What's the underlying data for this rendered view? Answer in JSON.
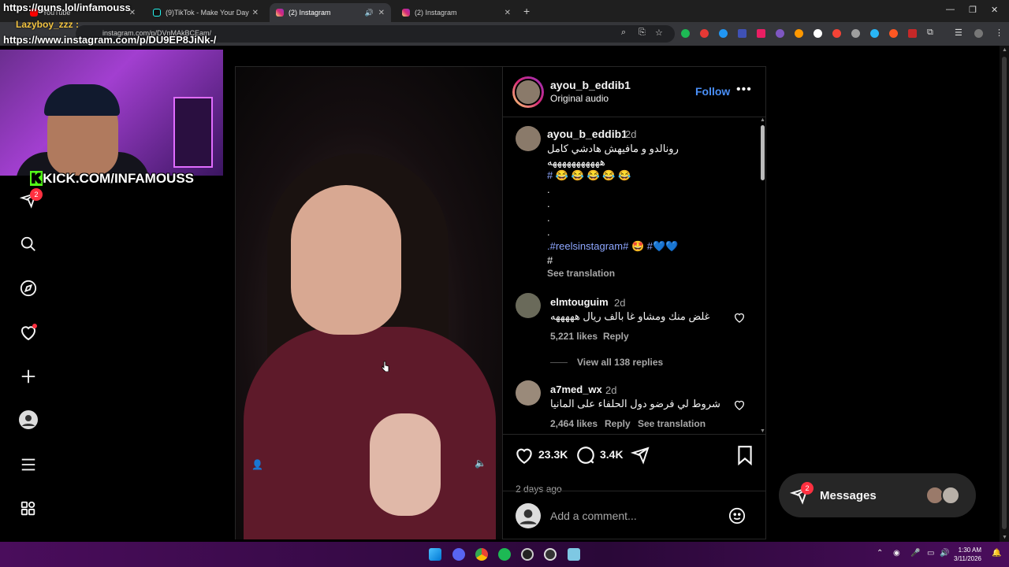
{
  "overlay": {
    "url1": "https://guns.lol/infamouss",
    "user": "Lazyboy_zzz :",
    "url2": "https://www.instagram.com/p/DU9EP8JiNk-/",
    "kick_k": "K",
    "kick_text": "KICK.COM/INFAMOUSS"
  },
  "tabs": [
    {
      "label": "YouTube"
    },
    {
      "label": "(9)TikTok - Make Your Day"
    },
    {
      "label": "(2) Instagram"
    },
    {
      "label": "(2) Instagram"
    }
  ],
  "address": "instagram.com/p/DVnMAkBCEam/",
  "nav": {
    "notifications_badge": "2"
  },
  "post": {
    "author": "ayou_b_eddib1",
    "audio": "Original audio",
    "follow_label": "Follow",
    "caption": {
      "user": "ayou_b_eddib1",
      "time": "2d",
      "line1": "رونالدو و مافيهش هادشي كامل",
      "line2": "هههههههههههه",
      "line3": "# 😂 😂 😂 😂 😂",
      "dot": ".",
      "hashtags": ".#reelsinstagram# 🤩 #💙💙",
      "hash": "#",
      "see_translation": "See translation"
    },
    "comments": [
      {
        "user": "elmtouguim",
        "time": "2d",
        "text": "غلض منك ومشاو غا بالف ريال هههههه",
        "likes": "5,221 likes",
        "reply": "Reply",
        "view_replies": "View all 138 replies"
      },
      {
        "user": "a7med_wx",
        "time": "2d",
        "text": "شروط لي فرضو دول الحلفاء على المانيا",
        "likes": "2,464 likes",
        "reply": "Reply",
        "see_translation": "See translation"
      }
    ],
    "like_count": "23.3K",
    "comment_count": "3.4K",
    "posted": "2 days ago",
    "add_comment_placeholder": "Add a comment..."
  },
  "messages": {
    "label": "Messages",
    "badge": "2"
  },
  "clock": {
    "time": "1:30 AM",
    "date": "3/11/2026"
  },
  "colors": {
    "accent": "#4a8ff7",
    "badge": "#ff3040",
    "kick": "#53fc18"
  }
}
